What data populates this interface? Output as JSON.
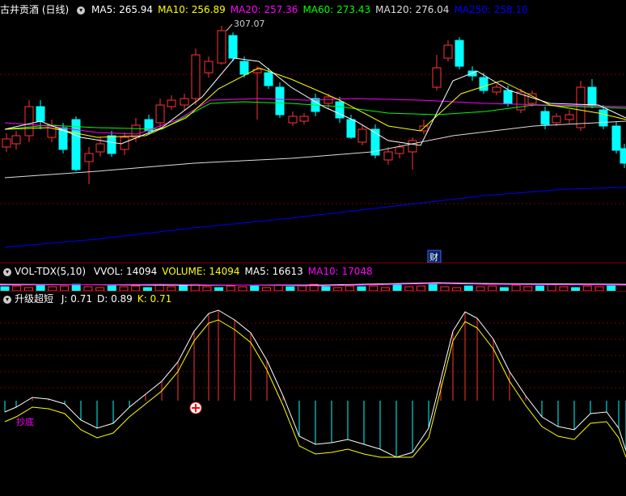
{
  "main": {
    "stock_name": "古井贡酒 (日线)",
    "ma": [
      {
        "label": "MA5: 265.94",
        "color": "#ffffff"
      },
      {
        "label": "MA10: 256.89",
        "color": "#ffff00"
      },
      {
        "label": "MA20: 257.36",
        "color": "#ff00ff"
      },
      {
        "label": "MA60: 273.43",
        "color": "#00ff00"
      },
      {
        "label": "MA120: 276.04",
        "color": "#dddddd"
      },
      {
        "label": "MA250: 258.10",
        "color": "#0000ff"
      }
    ],
    "peak_label": "307.07",
    "marker_label": "财"
  },
  "volume": {
    "title": "VOL-TDX(5,10)",
    "items": [
      {
        "label": "VVOL: 14094",
        "color": "#ffffff"
      },
      {
        "label": "VOLUME: 14094",
        "color": "#ffff00"
      },
      {
        "label": "MA5: 16613",
        "color": "#ffffff"
      },
      {
        "label": "MA10: 17048",
        "color": "#ff00ff"
      }
    ]
  },
  "indicator": {
    "title": "升级超短",
    "items": [
      {
        "label": "J: 0.71",
        "color": "#ffffff"
      },
      {
        "label": "D: 0.89",
        "color": "#ffffff"
      },
      {
        "label": "K: 0.71",
        "color": "#ffff00"
      }
    ],
    "tag_label": "抄底"
  },
  "colors": {
    "up": "#ff3333",
    "down": "#00ffff",
    "grid": "#7a0000"
  }
}
